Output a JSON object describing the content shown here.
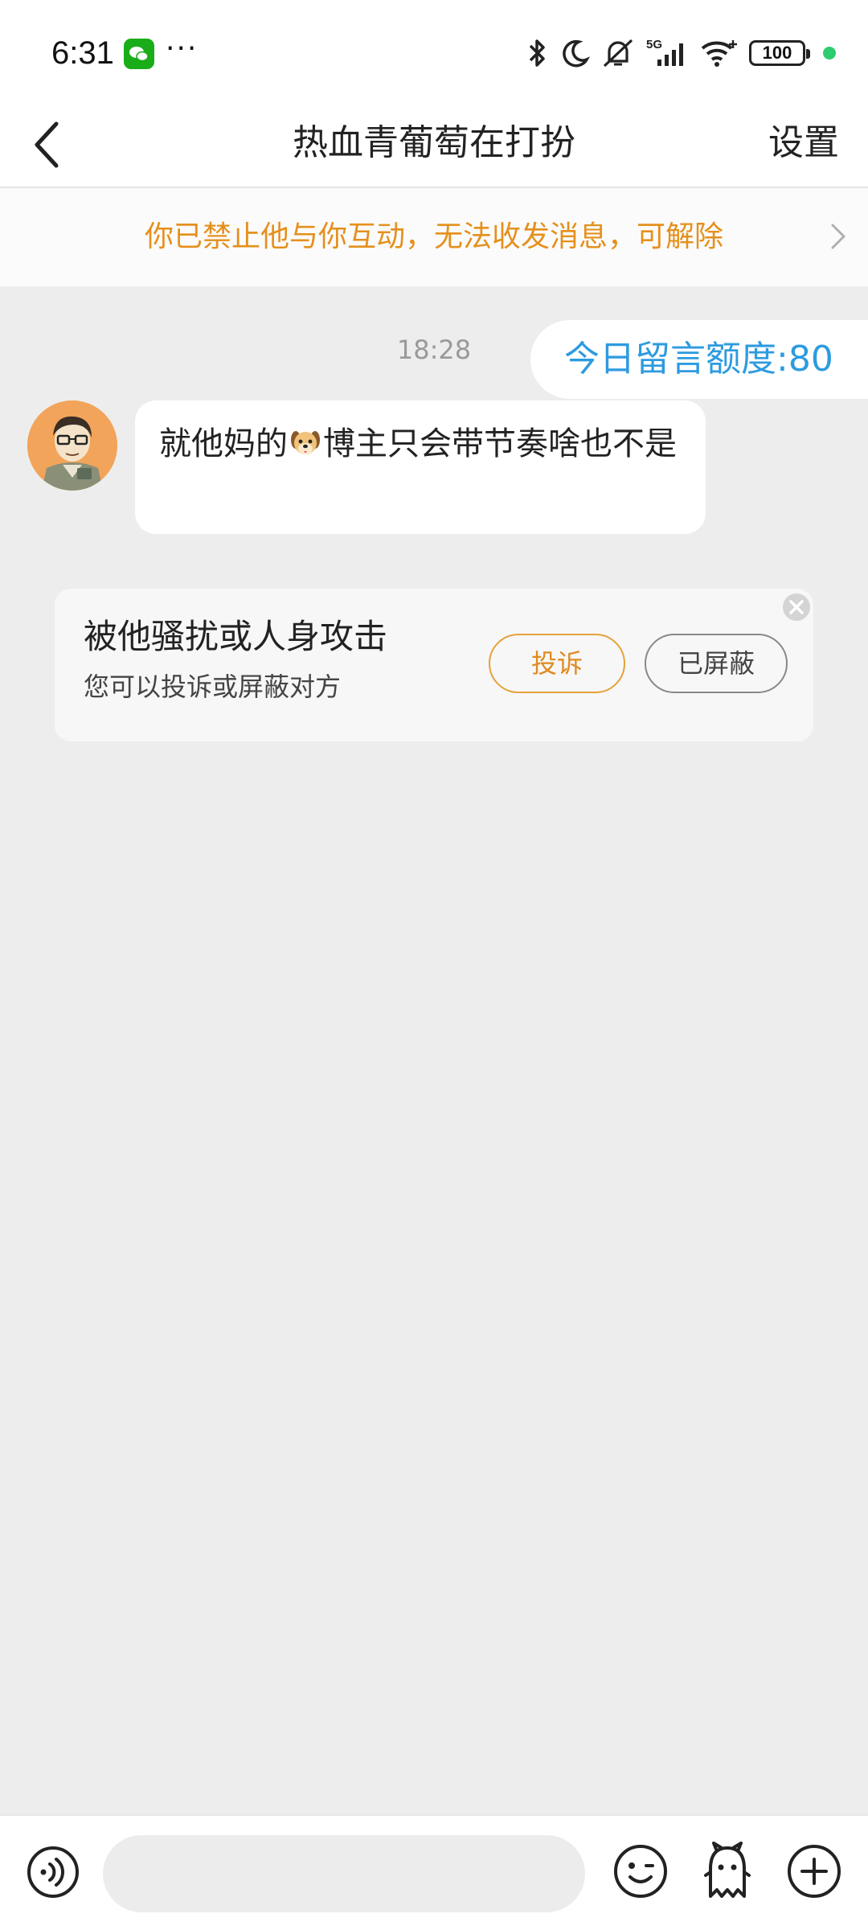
{
  "status_bar": {
    "time": "6:31",
    "dots": "···",
    "battery": "100",
    "icons": [
      "bluetooth-icon",
      "moon-icon",
      "mute-icon",
      "signal-5g-icon",
      "wifi-icon",
      "battery-icon"
    ]
  },
  "header": {
    "title": "热血青葡萄在打扮",
    "settings_label": "设置"
  },
  "banner": {
    "text": "你已禁止他与你互动，无法收发消息，可解除"
  },
  "chat": {
    "timestamp": "18:28",
    "quota": "今日留言额度:80",
    "message_before_emoji": "就他妈的",
    "message_after_emoji": "博主只会带节奏啥也不是"
  },
  "card": {
    "title": "被他骚扰或人身攻击",
    "subtitle": "您可以投诉或屏蔽对方",
    "report_label": "投诉",
    "blocked_label": "已屏蔽"
  },
  "colors": {
    "accent_orange": "#e5901d",
    "link_blue": "#2d9be0",
    "background": "#ededed"
  }
}
